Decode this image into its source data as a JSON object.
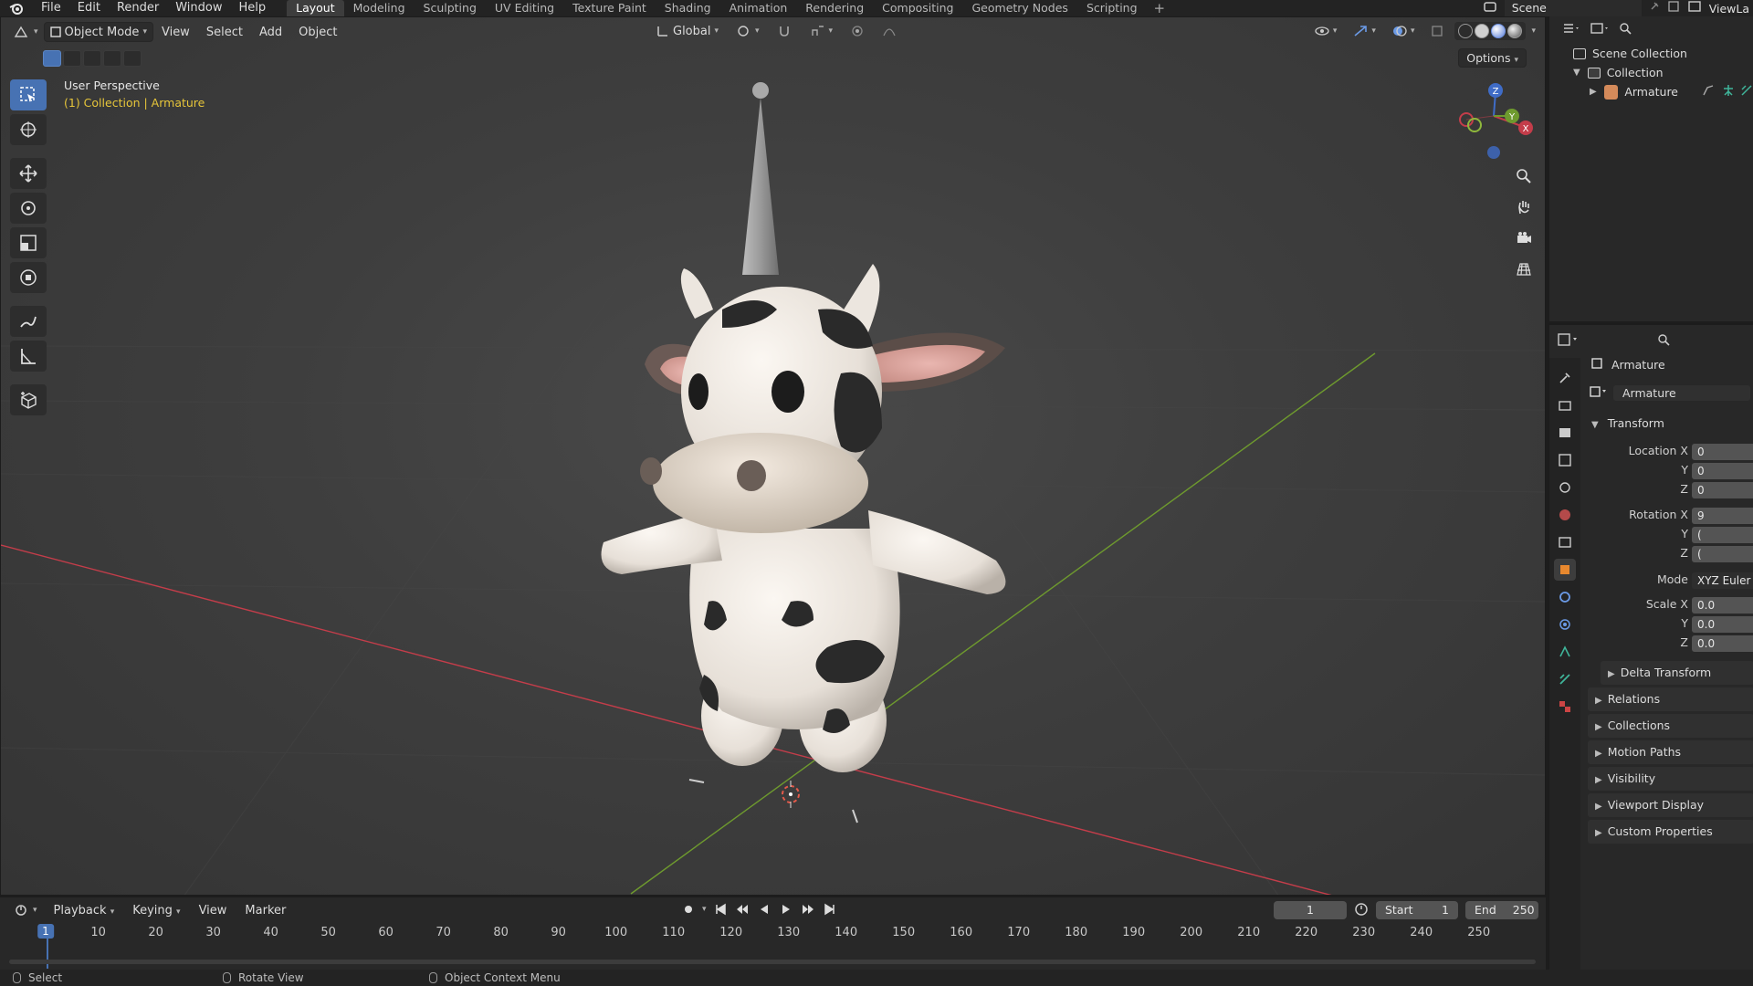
{
  "topbar": {
    "menus": [
      "File",
      "Edit",
      "Render",
      "Window",
      "Help"
    ],
    "workspaces": [
      "Layout",
      "Modeling",
      "Sculpting",
      "UV Editing",
      "Texture Paint",
      "Shading",
      "Animation",
      "Rendering",
      "Compositing",
      "Geometry Nodes",
      "Scripting"
    ],
    "active_workspace": "Layout",
    "add_tab": "+",
    "scene": "Scene",
    "view_layer": "ViewLa"
  },
  "viewport": {
    "mode": "Object Mode",
    "menus": [
      "View",
      "Select",
      "Add",
      "Object"
    ],
    "transform_orientation": "Global",
    "options": "Options",
    "title": "User Perspective",
    "subtitle": "(1) Collection | Armature",
    "gizmo": {
      "x": "X",
      "y": "Y",
      "z": "Z"
    },
    "colors": {
      "x_axis": "#c43d4a",
      "y_axis": "#6e9a2e",
      "accent": "#4772b3",
      "subtitle": "#e6c53a"
    }
  },
  "timeline": {
    "menus": [
      "Playback",
      "Keying",
      "View",
      "Marker"
    ],
    "current_frame": "1",
    "start_label": "Start",
    "start_value": "1",
    "end_label": "End",
    "end_value": "250",
    "ticks": [
      "10",
      "20",
      "30",
      "40",
      "50",
      "60",
      "70",
      "80",
      "90",
      "100",
      "110",
      "120",
      "130",
      "140",
      "150",
      "160",
      "170",
      "180",
      "190",
      "200",
      "210",
      "220",
      "230",
      "240",
      "250"
    ],
    "playhead_label": "1"
  },
  "statusbar": {
    "items": [
      "Select",
      "Rotate View",
      "Object Context Menu"
    ]
  },
  "outliner": {
    "scene_collection": "Scene Collection",
    "collection": "Collection",
    "armature": "Armature"
  },
  "properties": {
    "object_name": "Armature",
    "data_name": "Armature",
    "transform_panel": "Transform",
    "location_x_label": "Location X",
    "location_x": "0",
    "location_y_label": "Y",
    "location_y": "0",
    "location_z_label": "Z",
    "location_z": "0",
    "rotation_x_label": "Rotation X",
    "rotation_x": "9",
    "rotation_y_label": "Y",
    "rotation_y": "(",
    "rotation_z_label": "Z",
    "rotation_z": "(",
    "mode_label": "Mode",
    "mode_value": "XYZ Euler",
    "scale_x_label": "Scale X",
    "scale_x": "0.0",
    "scale_y_label": "Y",
    "scale_y": "0.0",
    "scale_z_label": "Z",
    "scale_z": "0.0",
    "delta_transform": "Delta Transform",
    "subpanels": [
      "Relations",
      "Collections",
      "Motion Paths",
      "Visibility",
      "Viewport Display",
      "Custom Properties"
    ]
  }
}
